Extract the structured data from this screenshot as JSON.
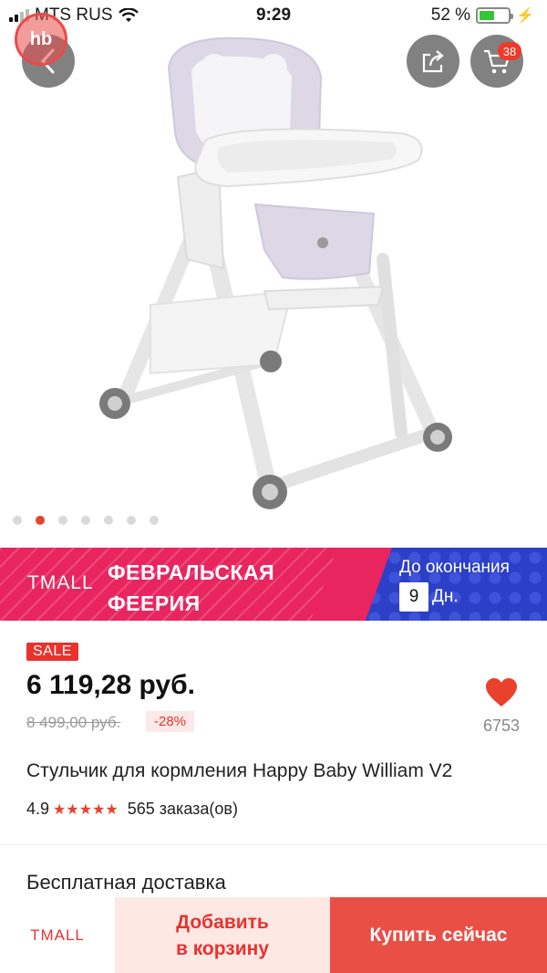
{
  "status_bar": {
    "carrier": "MTS RUS",
    "time": "9:29",
    "battery": "52 %"
  },
  "top_controls": {
    "logo_text": "hb",
    "cart_count": "38"
  },
  "gallery": {
    "image_count": 7,
    "active_index": 1
  },
  "banner": {
    "brand": "TMALL",
    "title_line1": "ФЕВРАЛЬСКАЯ",
    "title_line2": "ФЕЕРИЯ",
    "countdown_label": "До окончания",
    "countdown_value": "9",
    "countdown_unit": "Дн."
  },
  "product": {
    "badge": "SALE",
    "price": "6 119,28 руб.",
    "old_price": "8 499,00 руб.",
    "discount": "-28%",
    "wishlist_count": "6753",
    "title": "Стульчик для кормления Happy Baby William V2",
    "rating": "4.9",
    "stars": "★★★★★",
    "orders": "565 заказа(ов)",
    "delivery": "Бесплатная доставка"
  },
  "bottom_bar": {
    "brand": "TMALL",
    "add_to_cart_line1": "Добавить",
    "add_to_cart_line2": "в корзину",
    "buy_now": "Купить сейчас"
  },
  "colors": {
    "accent": "#e9322e",
    "banner_pink": "#e8255f",
    "banner_blue": "#2c40c7"
  }
}
